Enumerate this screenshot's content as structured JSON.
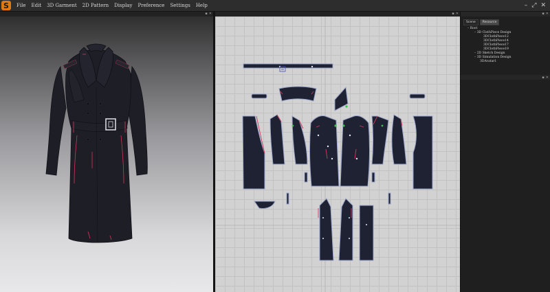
{
  "app": {
    "menu": [
      "File",
      "Edit",
      "3D Garment",
      "2D Pattern",
      "Display",
      "Preference",
      "Settings",
      "Help"
    ],
    "window_controls": [
      "–",
      "⤢",
      "✕"
    ]
  },
  "panel_controls": [
    "▪",
    "✕"
  ],
  "side_panel": {
    "tabs": [
      {
        "label": "Scene",
        "active": false
      },
      {
        "label": "Resource",
        "active": true
      }
    ],
    "tree": [
      {
        "label": "Root",
        "depth": 0,
        "expander": "–"
      },
      {
        "label": "3D ClothPiece Design",
        "depth": 1,
        "expander": "–"
      },
      {
        "label": "3DClothPiece12",
        "depth": 2,
        "expander": ""
      },
      {
        "label": "3DClothPiece14",
        "depth": 2,
        "expander": ""
      },
      {
        "label": "3DClothPiece17",
        "depth": 2,
        "expander": ""
      },
      {
        "label": "3DClothPiece19",
        "depth": 2,
        "expander": ""
      },
      {
        "label": "2D Sketch Design",
        "depth": 1,
        "expander": "–"
      },
      {
        "label": "3D Simulation Design",
        "depth": 1,
        "expander": "–"
      },
      {
        "label": "3DAvatar1",
        "depth": 2,
        "expander": ""
      }
    ]
  },
  "colors": {
    "fabric": "#1f2233",
    "fabric_outline": "#9aa4c8",
    "seam": "#d0395a",
    "accent_point": "#2ecc40"
  }
}
